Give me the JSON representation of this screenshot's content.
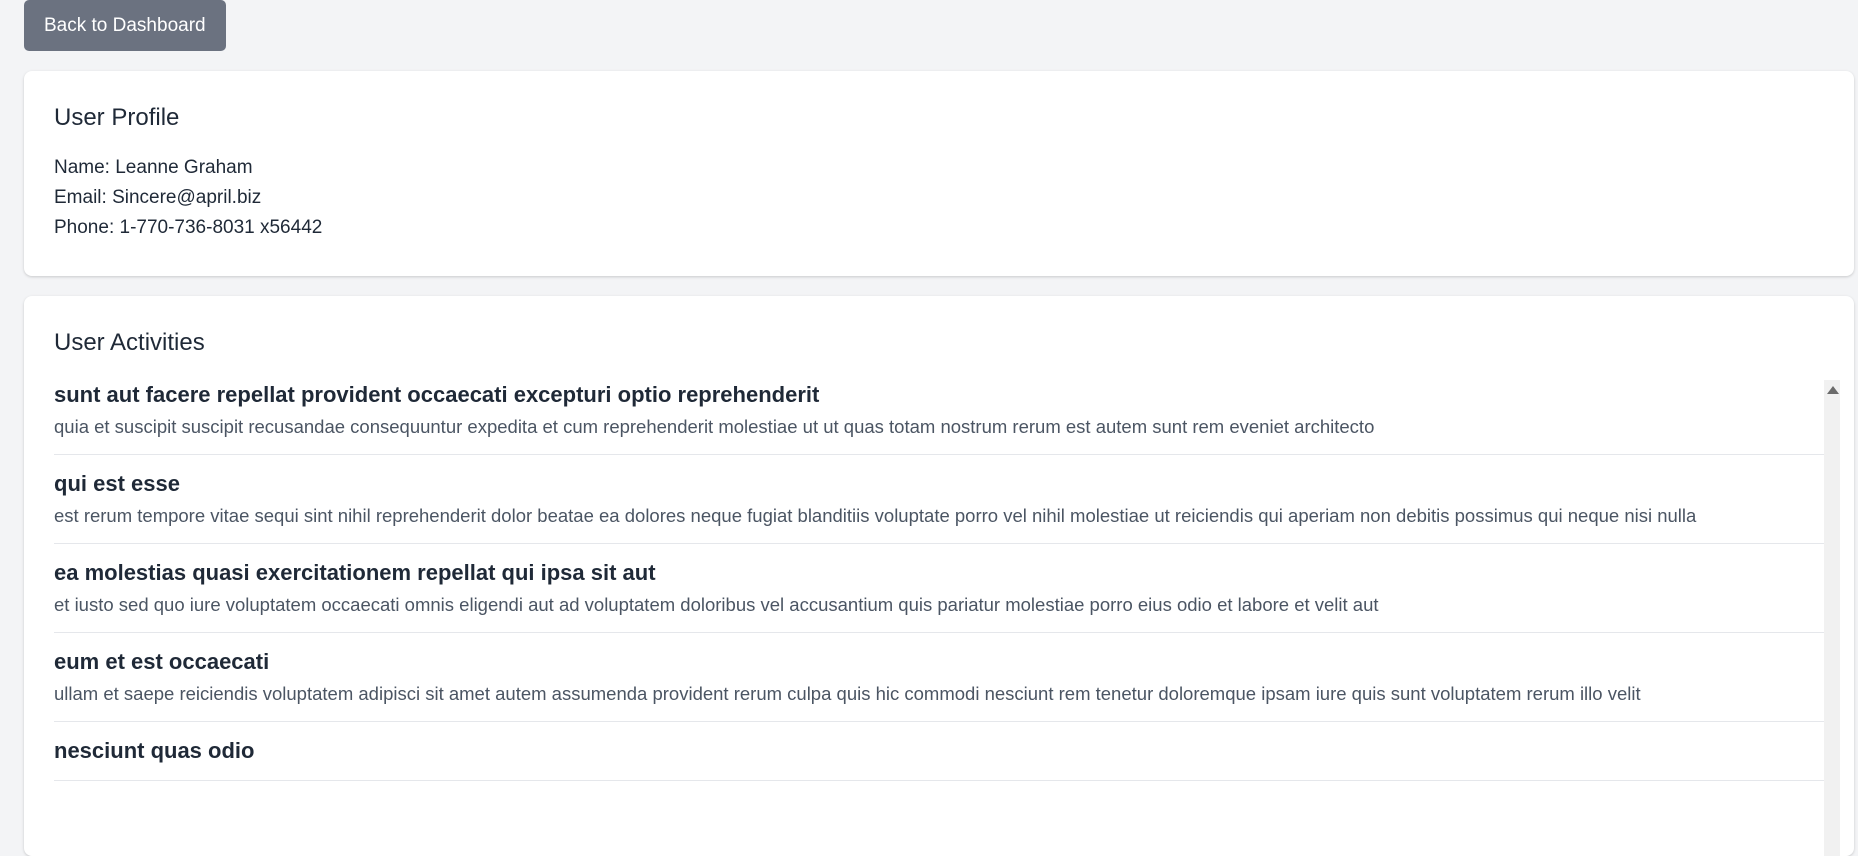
{
  "nav": {
    "back_label": "Back to Dashboard"
  },
  "profile": {
    "title": "User Profile",
    "name_line": "Name: Leanne Graham",
    "email_line": "Email: Sincere@april.biz",
    "phone_line": "Phone: 1-770-736-8031 x56442"
  },
  "activities": {
    "title": "User Activities",
    "items": [
      {
        "title": "sunt aut facere repellat provident occaecati excepturi optio reprehenderit",
        "body": "quia et suscipit suscipit recusandae consequuntur expedita et cum reprehenderit molestiae ut ut quas totam nostrum rerum est autem sunt rem eveniet architecto"
      },
      {
        "title": "qui est esse",
        "body": "est rerum tempore vitae sequi sint nihil reprehenderit dolor beatae ea dolores neque fugiat blanditiis voluptate porro vel nihil molestiae ut reiciendis qui aperiam non debitis possimus qui neque nisi nulla"
      },
      {
        "title": "ea molestias quasi exercitationem repellat qui ipsa sit aut",
        "body": "et iusto sed quo iure voluptatem occaecati omnis eligendi aut ad voluptatem doloribus vel accusantium quis pariatur molestiae porro eius odio et labore et velit aut"
      },
      {
        "title": "eum et est occaecati",
        "body": "ullam et saepe reiciendis voluptatem adipisci sit amet autem assumenda provident rerum culpa quis hic commodi nesciunt rem tenetur doloremque ipsam iure quis sunt voluptatem rerum illo velit"
      },
      {
        "title": "nesciunt quas odio",
        "body": ""
      }
    ]
  },
  "colors": {
    "page_bg": "#f3f4f6",
    "button_bg": "#6b7280",
    "card_bg": "#ffffff",
    "text_primary": "#1f2937",
    "text_secondary": "#4b5563",
    "divider": "#e5e7eb"
  },
  "icons": {
    "scroll_up": "scroll-up-arrow-icon"
  }
}
